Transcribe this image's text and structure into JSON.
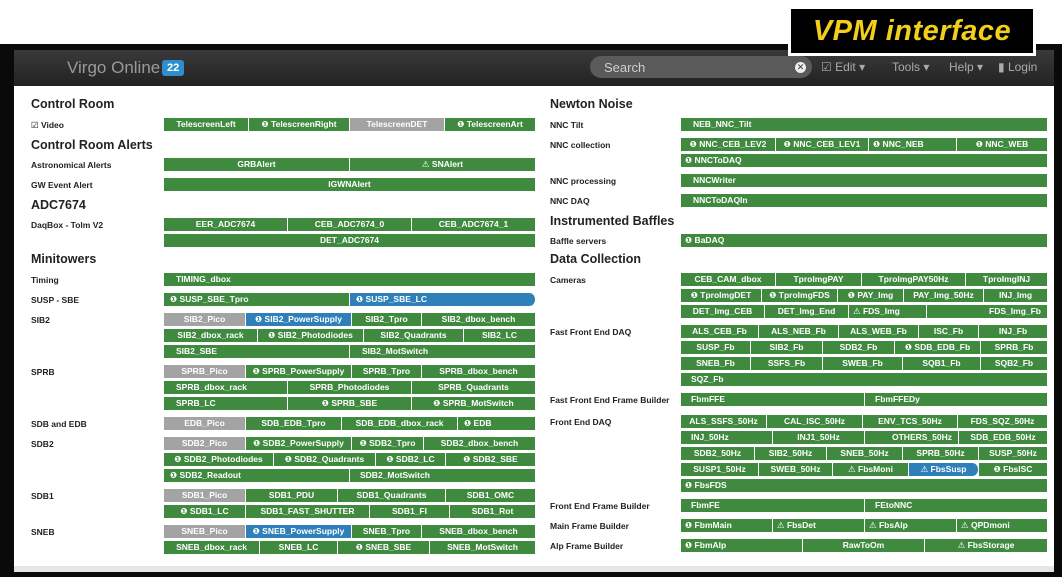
{
  "banner": {
    "title": "VPM interface"
  },
  "navbar": {
    "brand": "Virgo Online",
    "badge": "22",
    "search_placeholder": "Search",
    "edit": "☑ Edit ▾",
    "tools": "Tools ▾",
    "help": "Help ▾",
    "login": "▮ Login"
  },
  "left": {
    "control_room": "Control Room",
    "video": "☑ Video",
    "control_room_alerts": "Control Room Alerts",
    "astro_alerts": "Astronomical Alerts",
    "gw_event_alert": "GW Event Alert",
    "adc7674": "ADC7674",
    "daqbox": "DaqBox - Tolm V2",
    "minitowers": "Minitowers",
    "timing": "Timing",
    "susp_sbe": "SUSP - SBE",
    "sib2": "SIB2",
    "sprb": "SPRB",
    "sdb_edb": "SDB and EDB",
    "sdb2": "SDB2",
    "sdb1": "SDB1",
    "sneb": "SNEB"
  },
  "right": {
    "newton_noise": "Newton Noise",
    "nnc_tilt": "NNC Tilt",
    "nnc_collection": "NNC collection",
    "nnc_processing": "NNC processing",
    "nnc_daq": "NNC DAQ",
    "instrumented_baffles": "Instrumented Baffles",
    "baffle_servers": "Baffle servers",
    "data_collection": "Data Collection",
    "cameras": "Cameras",
    "fast_fe_daq": "Fast Front End DAQ",
    "fast_fe_frame_builder": "Fast Front End Frame Builder",
    "fe_daq": "Front End DAQ",
    "fe_frame_builder": "Front End Frame Builder",
    "main_frame_builder": "Main Frame Builder",
    "alp_frame_builder": "Alp Frame Builder"
  },
  "buttons": {
    "telescreen_left": "TelescreenLeft",
    "telescreen_right": "❶ TelescreenRight",
    "telescreen_det": "TelescreenDET",
    "telescreen_art": "❶ TelescreenArt",
    "grb_alert": "GRBAlert",
    "sn_alert": "⚠ SNAlert",
    "igwn_alert": "IGWNAlert",
    "eer_adc": "EER_ADC7674",
    "ceb_adc_0": "CEB_ADC7674_0",
    "ceb_adc_1": "CEB_ADC7674_1",
    "det_adc": "DET_ADC7674",
    "timing_dbox": "TIMING_dbox",
    "susp_sbe_tpro": "❶ SUSP_SBE_Tpro",
    "susp_sbe_lc": "❶ SUSP_SBE_LC",
    "sib2_pico": "SIB2_Pico",
    "sib2_powersupply": "❶ SIB2_PowerSupply",
    "sib2_tpro": "SIB2_Tpro",
    "sib2_dbox_bench": "SIB2_dbox_bench",
    "sib2_dbox_rack": "SIB2_dbox_rack",
    "sib2_photodiodes": "❶ SIB2_Photodiodes",
    "sib2_quadrants": "SIB2_Quadrants",
    "sib2_lc": "SIB2_LC",
    "sib2_sbe": "SIB2_SBE",
    "sib2_motswitch": "SIB2_MotSwitch",
    "sprb_pico": "SPRB_Pico",
    "sprb_powersupply": "❶ SPRB_PowerSupply",
    "sprb_tpro": "SPRB_Tpro",
    "sprb_dbox_bench": "SPRB_dbox_bench",
    "sprb_dbox_rack": "SPRB_dbox_rack",
    "sprb_photodiodes": "SPRB_Photodiodes",
    "sprb_quadrants": "SPRB_Quadrants",
    "sprb_lc": "SPRB_LC",
    "sprb_sbe": "❶ SPRB_SBE",
    "sprb_motswitch": "❶ SPRB_MotSwitch",
    "edb_pico": "EDB_Pico",
    "sdb_edb_tpro": "SDB_EDB_Tpro",
    "sdb_edb_dbox_rack": "SDB_EDB_dbox_rack",
    "edb": "❶ EDB",
    "sdb2_pico": "SDB2_Pico",
    "sdb2_powersupply": "❶ SDB2_PowerSupply",
    "sdb2_tpro": "❶ SDB2_Tpro",
    "sdb2_dbox_bench": "SDB2_dbox_bench",
    "sdb2_photodiodes": "❶ SDB2_Photodiodes",
    "sdb2_quadrants": "❶ SDB2_Quadrants",
    "sdb2_lc": "❶ SDB2_LC",
    "sdb2_sbe": "❶ SDB2_SBE",
    "sdb2_readout": "❶ SDB2_Readout",
    "sdb2_motswitch": "SDB2_MotSwitch",
    "sdb1_pico": "SDB1_Pico",
    "sdb1_pdu": "SDB1_PDU",
    "sdb1_quadrants": "SDB1_Quadrants",
    "sdb1_omc": "SDB1_OMC",
    "sdb1_lc": "❶ SDB1_LC",
    "sdb1_fast_shutter": "SDB1_FAST_SHUTTER",
    "sdb1_fi": "SDB1_FI",
    "sdb1_rot": "SDB1_Rot",
    "sneb_pico": "SNEB_Pico",
    "sneb_powersupply": "❶ SNEB_PowerSupply",
    "sneb_tpro": "SNEB_Tpro",
    "sneb_dbox_bench": "SNEB_dbox_bench",
    "sneb_dbox_rack": "SNEB_dbox_rack",
    "sneb_lc": "SNEB_LC",
    "sneb_sbe": "❶ SNEB_SBE",
    "sneb_motswitch": "SNEB_MotSwitch",
    "neb_nnc_tilt": "NEB_NNC_Tilt",
    "nnc_ceb_lev2": "❶ NNC_CEB_LEV2",
    "nnc_ceb_lev1": "❶ NNC_CEB_LEV1",
    "nnc_neb": "❶ NNC_NEB",
    "nnc_web": "❶ NNC_WEB",
    "nnc_to_daq": "❶ NNCToDAQ",
    "nnc_writer": "NNCWriter",
    "nnc_to_daq_in": "NNCToDAQIn",
    "badaq": "❶ BaDAQ",
    "ceb_cam_dbox": "CEB_CAM_dbox",
    "tproimg_pay": "TproImgPAY",
    "tproimg_pay50hz": "TproImgPAY50Hz",
    "tproimg_inj": "TproImgINJ",
    "tproimg_det": "❶ TproImgDET",
    "tproimg_fds": "❶ TproImgFDS",
    "pay_img": "❶ PAY_Img",
    "pay_img_50hz": "PAY_Img_50Hz",
    "inj_img": "INJ_Img",
    "det_img_ceb": "DET_Img_CEB",
    "det_img_end": "DET_Img_End",
    "fds_img": "⚠ FDS_Img",
    "fds_img_fb": "FDS_Img_Fb",
    "als_ceb_fb": "ALS_CEB_Fb",
    "als_neb_fb": "ALS_NEB_Fb",
    "als_web_fb": "ALS_WEB_Fb",
    "isc_fb": "ISC_Fb",
    "inj_fb": "INJ_Fb",
    "susp_fb": "SUSP_Fb",
    "sib2_fb": "SIB2_Fb",
    "sdb2_fb": "SDB2_Fb",
    "sdb_edb_fb": "❶ SDB_EDB_Fb",
    "sprb_fb": "SPRB_Fb",
    "sneb_fb": "SNEB_Fb",
    "ssfs_fb": "SSFS_Fb",
    "sweb_fb": "SWEB_Fb",
    "sqb1_fb": "SQB1_Fb",
    "sqb2_fb": "SQB2_Fb",
    "sqz_fb": "SQZ_Fb",
    "fbmffe": "FbmFFE",
    "fbmffedy": "FbmFFEDy",
    "als_ssfs_50hz": "ALS_SSFS_50Hz",
    "cal_isc_50hz": "CAL_ISC_50Hz",
    "env_tcs_50hz": "ENV_TCS_50Hz",
    "fds_sqz_50hz": "FDS_SQZ_50Hz",
    "inj_50hz": "INJ_50Hz",
    "inj1_50hz": "INJ1_50Hz",
    "others_50hz": "OTHERS_50Hz",
    "sdb_edb_50hz": "SDB_EDB_50Hz",
    "sdb2_50hz": "SDB2_50Hz",
    "sib2_50hz": "SIB2_50Hz",
    "sneb_50hz": "SNEB_50Hz",
    "sprb_50hz": "SPRB_50Hz",
    "susp_50hz": "SUSP_50Hz",
    "susp1_50hz": "SUSP1_50Hz",
    "sweb_50hz": "SWEB_50Hz",
    "fbs_moni": "⚠ FbsMoni",
    "fbs_susp": "⚠ FbsSusp",
    "fbs_isc": "❶ FbsISC",
    "fbs_fds": "❶ FbsFDS",
    "fbmfe": "FbmFE",
    "fe_to_nnc": "FEtoNNC",
    "fbm_main": "❶ FbmMain",
    "fbs_det": "⚠ FbsDet",
    "fbs_alp": "⚠ FbsAlp",
    "qpd_moni": "⚠ QPDmoni",
    "fbm_alp": "❶ FbmAlp",
    "raw_to_om": "RawToOm",
    "fbs_storage": "⚠ FbsStorage"
  }
}
